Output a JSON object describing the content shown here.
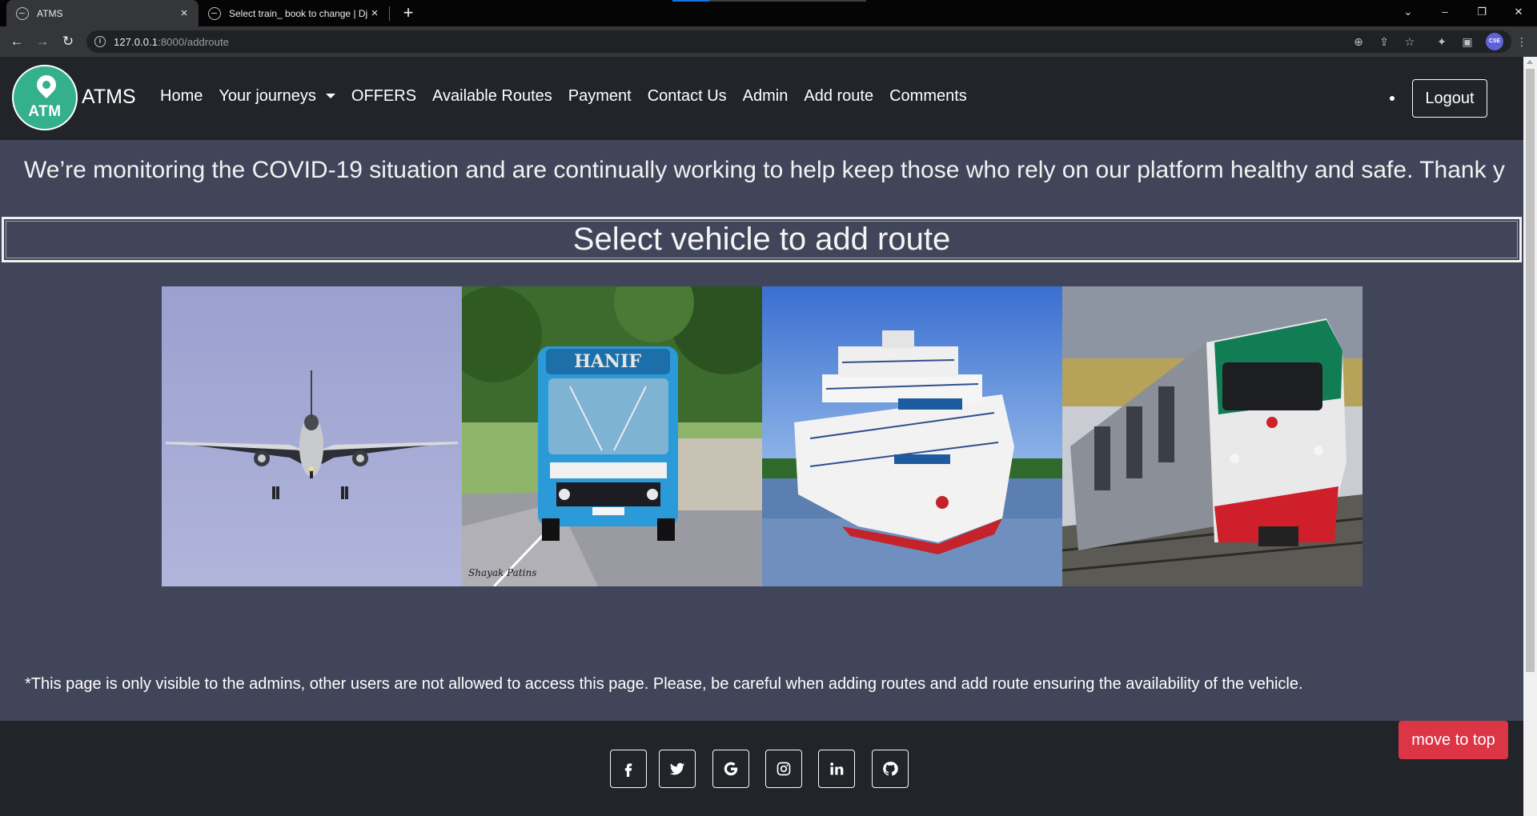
{
  "browser": {
    "tabs": [
      {
        "title": "ATMS",
        "active": true
      },
      {
        "title": "Select train_ book to change | Dj",
        "active": false
      }
    ],
    "url_host": "127.0.0.1",
    "url_rest": ":8000/addroute",
    "profile_initials": "CSE"
  },
  "nav": {
    "logo_text": "ATM",
    "brand": "ATMS",
    "links": [
      "Home",
      "Your journeys",
      "OFFERS",
      "Available Routes",
      "Payment",
      "Contact Us",
      "Admin",
      "Add route",
      "Comments"
    ],
    "logout": "Logout"
  },
  "banner": {
    "text": "We’re monitoring the COVID-19 situation and are continually working to help keep those who rely on our platform healthy and safe. Thank y"
  },
  "main": {
    "heading": "Select vehicle to add route",
    "vehicles": [
      {
        "name": "plane"
      },
      {
        "name": "bus",
        "bus_sign": "HANIF",
        "watermark": "Shayak Patins"
      },
      {
        "name": "launch"
      },
      {
        "name": "train"
      }
    ],
    "notice": "*This page is only visible to the admins, other users are not allowed to access this page. Please, be careful when adding routes and add route ensuring the availability of the vehicle."
  },
  "footer": {
    "social": [
      "facebook",
      "twitter",
      "google",
      "instagram",
      "linkedin",
      "github"
    ],
    "move_to_top": "move to top"
  },
  "colors": {
    "page_bg": "#414559",
    "nav_bg": "#212529",
    "logo_green": "#35b08c",
    "danger": "#dc3545"
  }
}
